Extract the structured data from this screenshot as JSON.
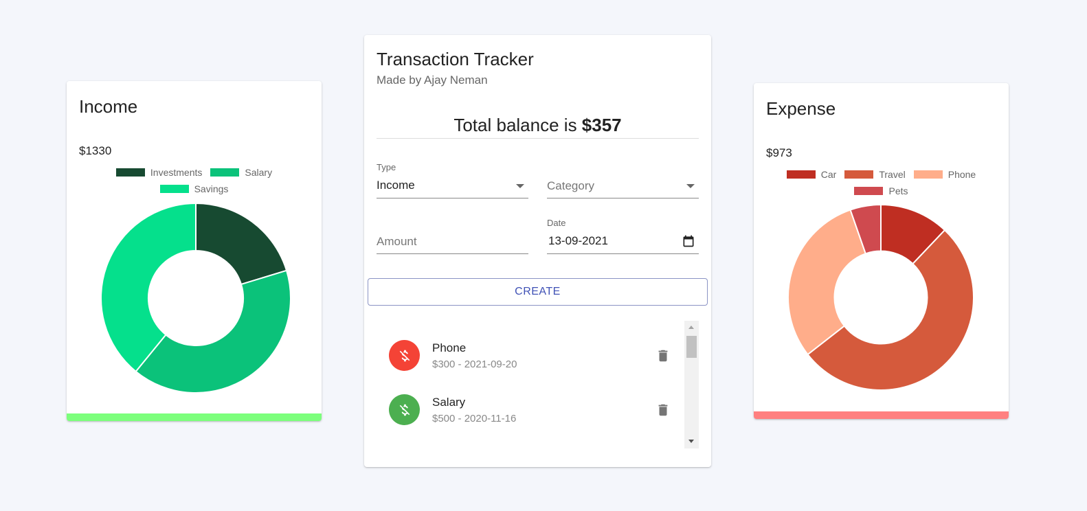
{
  "income": {
    "title": "Income",
    "amount": "$1330",
    "bar_color": "#7cff7c"
  },
  "expense": {
    "title": "Expense",
    "amount": "$973",
    "bar_color": "#ff8080"
  },
  "tracker": {
    "title": "Transaction Tracker",
    "subtitle": "Made by Ajay Neman",
    "balance_prefix": "Total balance is ",
    "balance_value": "$357",
    "form": {
      "type_label": "Type",
      "type_value": "Income",
      "category_placeholder": "Category",
      "amount_placeholder": "Amount",
      "date_label": "Date",
      "date_value": "13-09-2021"
    },
    "create_label": "CREATE",
    "transactions": [
      {
        "name": "Phone",
        "detail": "$300 - 2021-09-20",
        "kind": "expense",
        "color": "#f44336",
        "icon": "money-off-icon"
      },
      {
        "name": "Salary",
        "detail": "$500 - 2020-11-16",
        "kind": "income",
        "color": "#4caf50",
        "icon": "money-off-icon"
      }
    ]
  },
  "chart_data": [
    {
      "type": "pie",
      "categories": [
        "Investments",
        "Salary",
        "Savings"
      ],
      "values": [
        270,
        540,
        520
      ],
      "colors": [
        "#174a31",
        "#0bc27a",
        "#05e08c"
      ],
      "legend_position": "top"
    },
    {
      "type": "pie",
      "categories": [
        "Car",
        "Travel",
        "Phone",
        "Pets"
      ],
      "values": [
        120,
        520,
        300,
        53
      ],
      "colors": [
        "#bf2e22",
        "#d55a3c",
        "#ffad8a",
        "#cf4a4f"
      ],
      "legend_position": "top"
    }
  ]
}
